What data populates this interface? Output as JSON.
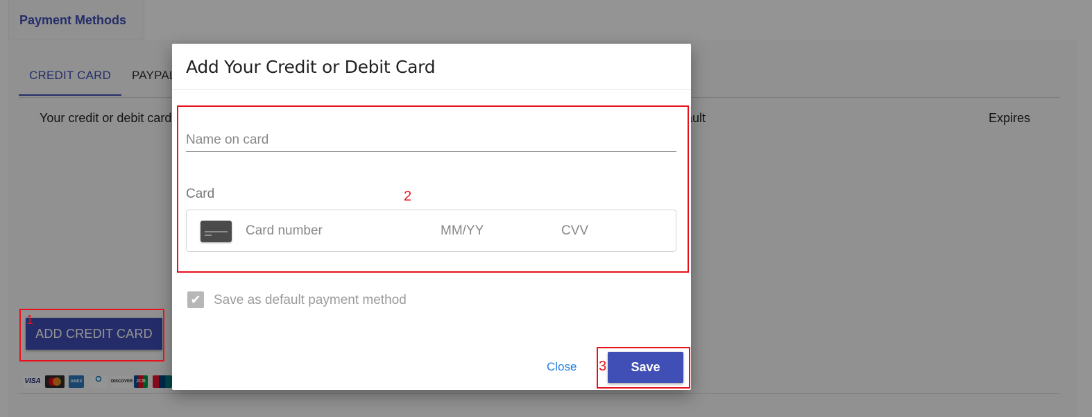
{
  "colors": {
    "primary": "#3f4fb5",
    "link": "#1e7fe0",
    "annotation": "#e8101a"
  },
  "background": {
    "section_title": "Payment Methods",
    "tabs": [
      "CREDIT CARD",
      "PAYPAL"
    ],
    "columns": {
      "card": "Your credit or debit cards",
      "default": "Default",
      "expires": "Expires"
    },
    "add_button": "ADD CREDIT CARD",
    "card_logos": [
      "VISA",
      "MasterCard",
      "AMEX",
      "Diners Club",
      "DISCOVER",
      "JCB",
      "UnionPay"
    ]
  },
  "dialog": {
    "title": "Add Your Credit or Debit Card",
    "name_placeholder": "Name on card",
    "card_label": "Card",
    "card_icon": "credit-card-icon",
    "card_number_placeholder": "Card number",
    "expiry_placeholder": "MM/YY",
    "cvv_placeholder": "CVV",
    "default_checkbox_label": "Save as default payment method",
    "default_checkbox_checked": true,
    "close_label": "Close",
    "save_label": "Save"
  },
  "annotations": [
    "1",
    "2",
    "3"
  ]
}
